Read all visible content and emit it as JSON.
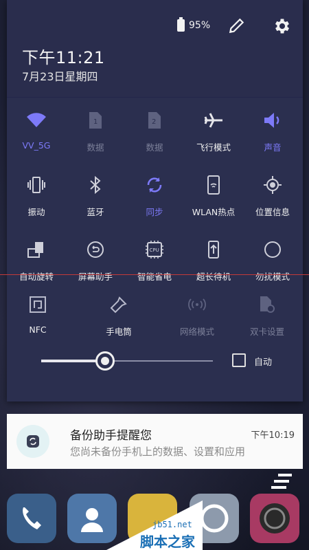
{
  "status": {
    "battery": "95%"
  },
  "header": {
    "time": "下午11:21",
    "date": "7月23日星期四"
  },
  "tiles": [
    {
      "label": "VV_5G",
      "icon": "wifi-icon",
      "state": "active"
    },
    {
      "label": "数据",
      "icon": "sim1-icon",
      "state": "dim"
    },
    {
      "label": "数据",
      "icon": "sim2-icon",
      "state": "dim"
    },
    {
      "label": "飞行模式",
      "icon": "airplane-icon",
      "state": "normal"
    },
    {
      "label": "声音",
      "icon": "volume-icon",
      "state": "active"
    },
    {
      "label": "振动",
      "icon": "vibrate-icon",
      "state": "normal"
    },
    {
      "label": "蓝牙",
      "icon": "bluetooth-icon",
      "state": "normal"
    },
    {
      "label": "同步",
      "icon": "sync-icon",
      "state": "active"
    },
    {
      "label": "WLAN热点",
      "icon": "hotspot-icon",
      "state": "normal"
    },
    {
      "label": "位置信息",
      "icon": "location-icon",
      "state": "normal"
    },
    {
      "label": "自动旋转",
      "icon": "rotate-icon",
      "state": "normal"
    },
    {
      "label": "屏幕助手",
      "icon": "screen-assistant-icon",
      "state": "normal"
    },
    {
      "label": "智能省电",
      "icon": "cpu-icon",
      "icon_text": "CPU",
      "state": "normal"
    },
    {
      "label": "超长待机",
      "icon": "long-standby-icon",
      "state": "normal"
    },
    {
      "label": "勿扰模式",
      "icon": "do-not-disturb-icon",
      "state": "normal"
    },
    {
      "label": "NFC",
      "icon": "nfc-icon",
      "state": "normal"
    },
    {
      "label": "手电筒",
      "icon": "flashlight-icon",
      "state": "normal"
    },
    {
      "label": "网络模式",
      "icon": "network-mode-icon",
      "state": "dim"
    },
    {
      "label": "双卡设置",
      "icon": "dual-sim-icon",
      "state": "dim"
    }
  ],
  "brightness": {
    "level": 0.37,
    "auto_label": "自动",
    "auto_checked": false
  },
  "notification": {
    "title": "备份助手提醒您",
    "time": "下午10:19",
    "body": "您尚未备份手机上的数据、设置和应用"
  },
  "watermark": {
    "site": "jb51.net",
    "name": "脚本之家"
  },
  "colors": {
    "accent": "#7d7af8",
    "panel": "#2b2f4f",
    "dim": "#7b7f98"
  }
}
